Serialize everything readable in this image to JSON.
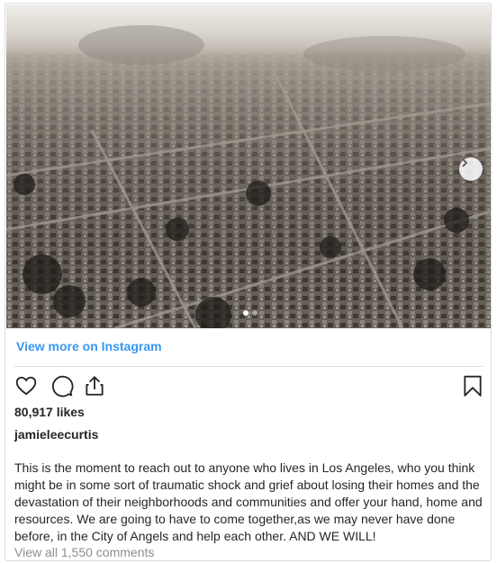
{
  "post": {
    "image_alt": "Aerial view of burned neighborhood in Los Angeles",
    "carousel": {
      "current": 1,
      "total": 2
    },
    "view_more_label": "View more on Instagram",
    "likes": "80,917 likes",
    "username": "jamieleecurtis",
    "caption": "This is the moment to reach out to anyone who lives in Los Angeles, who you think might be in some sort of traumatic shock and grief about losing their homes and the devastation of their neighborhoods and communities and offer your hand, home and resources. We are going to have to come together,as we may never have done before, in the City of Angels and help each other. AND WE WILL!",
    "comments_label": "View all 1,550 comments"
  },
  "icons": {
    "like": "heart-icon",
    "comment": "comment-icon",
    "share": "share-icon",
    "save": "bookmark-icon",
    "next": "chevron-right-icon"
  },
  "colors": {
    "link": "#3897f0",
    "text": "#262626",
    "muted": "#8e8e8e"
  }
}
